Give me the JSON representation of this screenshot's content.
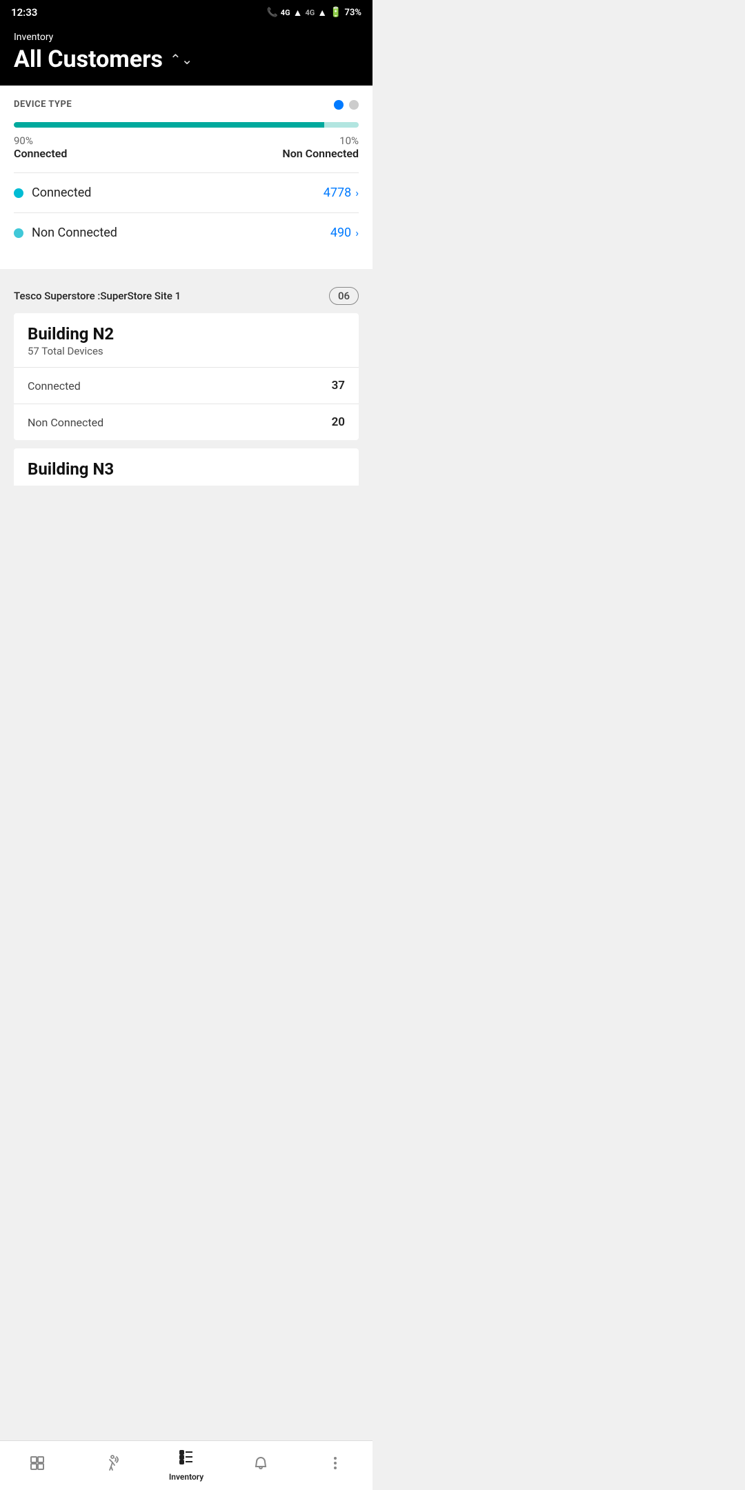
{
  "statusBar": {
    "time": "12:33",
    "battery": "73%"
  },
  "header": {
    "subtitle": "Inventory",
    "title": "All Customers",
    "chevron": "⌃⌄"
  },
  "deviceType": {
    "sectionLabel": "DEVICE TYPE",
    "connectedPct": "90%",
    "connectedLabel": "Connected",
    "nonConnectedPct": "10%",
    "nonConnectedLabel": "Non Connected",
    "connectedCount": "4778",
    "nonConnectedCount": "490",
    "progressFillWidth": "90%"
  },
  "site": {
    "name": "Tesco Superstore :SuperStore Site 1",
    "badge": "06"
  },
  "buildingN2": {
    "name": "Building N2",
    "totalDevices": "57 Total Devices",
    "connected": "37",
    "nonConnected": "20",
    "connectedLabel": "Connected",
    "nonConnectedLabel": "Non Connected"
  },
  "buildingN3": {
    "name": "Building N3"
  },
  "bottomNav": {
    "items": [
      {
        "icon": "⊞",
        "label": "",
        "name": "dashboard-nav",
        "active": false
      },
      {
        "icon": "🚶",
        "label": "",
        "name": "tracking-nav",
        "active": false
      },
      {
        "icon": "☰",
        "label": "Inventory",
        "name": "inventory-nav",
        "active": true
      },
      {
        "icon": "🔔",
        "label": "",
        "name": "alerts-nav",
        "active": false
      },
      {
        "icon": "⋮",
        "label": "",
        "name": "more-nav",
        "active": false
      }
    ]
  }
}
